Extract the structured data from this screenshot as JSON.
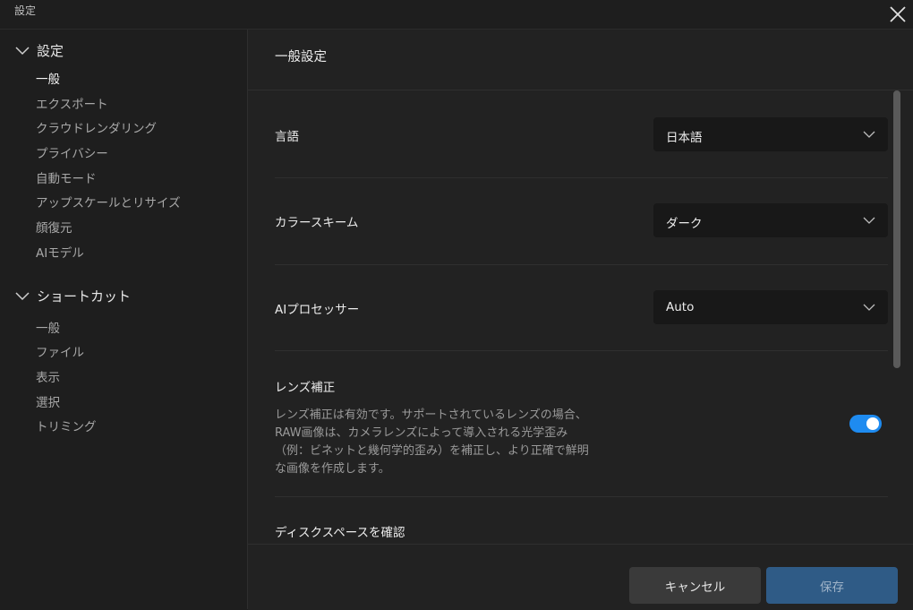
{
  "window": {
    "title": "設定"
  },
  "sidebar": {
    "groups": [
      {
        "label": "設定",
        "items": [
          "一般",
          "エクスポート",
          "クラウドレンダリング",
          "プライバシー",
          "自動モード",
          "アップスケールとリサイズ",
          "顔復元",
          "AIモデル"
        ]
      },
      {
        "label": "ショートカット",
        "items": [
          "一般",
          "ファイル",
          "表示",
          "選択",
          "トリミング"
        ]
      }
    ]
  },
  "main": {
    "title": "一般設定",
    "language": {
      "label": "言語",
      "value": "日本語"
    },
    "color_scheme": {
      "label": "カラースキーム",
      "value": "ダーク"
    },
    "ai_processor": {
      "label": "AIプロセッサー",
      "value": "Auto"
    },
    "lens_correction": {
      "label": "レンズ補正",
      "description_lines": [
        "レンズ補正は有効です。サポートされているレンズの場合、",
        "RAW画像は、カメラレンズによって導入される光学歪み",
        "（例：ビネットと幾何学的歪み）を補正し、より正確で鮮明",
        "な画像を作成します。"
      ],
      "enabled": true
    },
    "disk_space": {
      "label": "ディスクスペースを確認"
    }
  },
  "footer": {
    "cancel_label": "キャンセル",
    "save_label": "保存"
  },
  "colors": {
    "accent": "#1e8bf0",
    "save_button": "#2f5b86"
  }
}
